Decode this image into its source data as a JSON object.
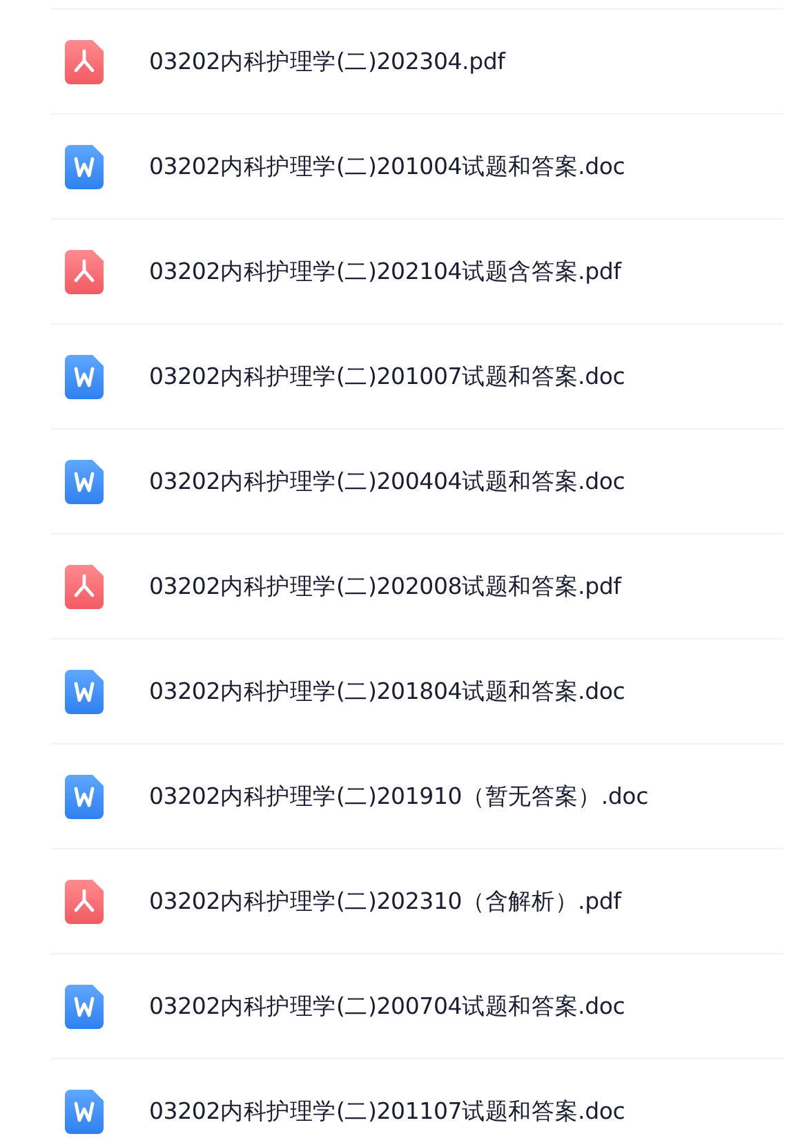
{
  "files": [
    {
      "kind": "pdf",
      "name": "03202内科护理学(二)202304.pdf"
    },
    {
      "kind": "word",
      "name": "03202内科护理学(二)201004试题和答案.doc"
    },
    {
      "kind": "pdf",
      "name": "03202内科护理学(二)202104试题含答案.pdf"
    },
    {
      "kind": "word",
      "name": "03202内科护理学(二)201007试题和答案.doc"
    },
    {
      "kind": "word",
      "name": "03202内科护理学(二)200404试题和答案.doc"
    },
    {
      "kind": "pdf",
      "name": "03202内科护理学(二)202008试题和答案.pdf"
    },
    {
      "kind": "word",
      "name": "03202内科护理学(二)201804试题和答案.doc"
    },
    {
      "kind": "word",
      "name": "03202内科护理学(二)201910（暂无答案）.doc"
    },
    {
      "kind": "pdf",
      "name": "03202内科护理学(二)202310（含解析）.pdf"
    },
    {
      "kind": "word",
      "name": "03202内科护理学(二)200704试题和答案.doc"
    },
    {
      "kind": "word",
      "name": "03202内科护理学(二)201107试题和答案.doc"
    }
  ]
}
